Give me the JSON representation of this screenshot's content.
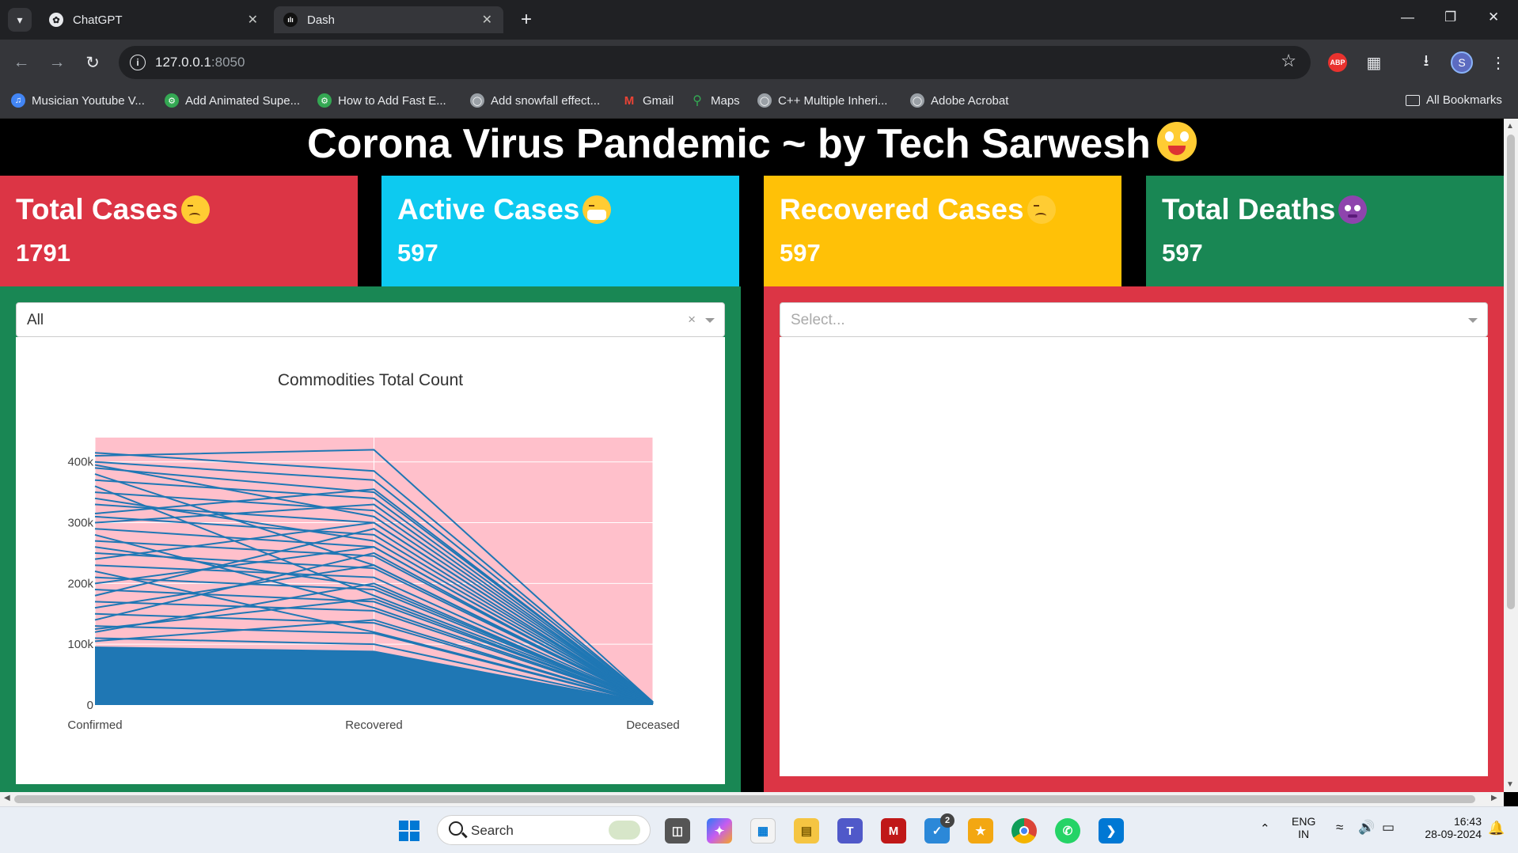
{
  "browser": {
    "tabs": [
      {
        "title": "ChatGPT",
        "icon": "chatgpt-icon"
      },
      {
        "title": "Dash",
        "icon": "dash-icon",
        "active": true
      }
    ],
    "url_host": "127.0.0.1",
    "url_port": ":8050",
    "bookmarks": [
      {
        "label": "Musician Youtube V...",
        "color": "#4285f4"
      },
      {
        "label": "Add Animated Supe...",
        "color": "#34a853"
      },
      {
        "label": "How to Add Fast E...",
        "color": "#34a853"
      },
      {
        "label": "Add snowfall effect...",
        "color": "#9aa0a6"
      },
      {
        "label": "Gmail",
        "color": "#ea4335"
      },
      {
        "label": "Maps",
        "color": "#fbbc05"
      },
      {
        "label": "C++ Multiple Inheri...",
        "color": "#9aa0a6"
      },
      {
        "label": "Adobe Acrobat",
        "color": "#9aa0a6"
      }
    ],
    "all_bookmarks": "All Bookmarks",
    "abp_label": "ABP",
    "profile_initial": "S"
  },
  "page": {
    "title": "Corona Virus Pandemic ~ by Tech Sarwesh",
    "cards": [
      {
        "title": "Total Cases",
        "value": "1791",
        "color": "#dc3545"
      },
      {
        "title": "Active Cases",
        "value": "597",
        "color": "#0dcaf0"
      },
      {
        "title": "Recovered Cases",
        "value": "597",
        "color": "#ffc107"
      },
      {
        "title": "Total Deaths",
        "value": "597",
        "color": "#198754"
      }
    ],
    "left_dropdown_value": "All",
    "right_dropdown_placeholder": "Select...",
    "left_panel_color": "#198754",
    "right_panel_color": "#dc3545"
  },
  "chart_data": {
    "type": "line",
    "title": "Commodities Total Count",
    "categories": [
      "Confirmed",
      "Recovered",
      "Deceased"
    ],
    "ylim": [
      0,
      440000
    ],
    "yticks": [
      0,
      100000,
      200000,
      300000,
      400000
    ],
    "ytick_labels": [
      "0",
      "100k",
      "200k",
      "300k",
      "400k"
    ],
    "plot_bgcolor": "#ffc0cb",
    "line_color": "#1f77b4",
    "series": [
      {
        "values": [
          410000,
          420000,
          5000
        ]
      },
      {
        "values": [
          415000,
          385000,
          4800
        ]
      },
      {
        "values": [
          400000,
          370000,
          4500
        ]
      },
      {
        "values": [
          390000,
          350000,
          4300
        ]
      },
      {
        "values": [
          370000,
          340000,
          4100
        ]
      },
      {
        "values": [
          350000,
          320000,
          3900
        ]
      },
      {
        "values": [
          330000,
          300000,
          3600
        ]
      },
      {
        "values": [
          310000,
          280000,
          3300
        ]
      },
      {
        "values": [
          290000,
          260000,
          3100
        ]
      },
      {
        "values": [
          270000,
          245000,
          2900
        ]
      },
      {
        "values": [
          250000,
          225000,
          2700
        ]
      },
      {
        "values": [
          230000,
          210000,
          2500
        ]
      },
      {
        "values": [
          210000,
          190000,
          2300
        ]
      },
      {
        "values": [
          190000,
          170000,
          2100
        ]
      },
      {
        "values": [
          170000,
          155000,
          1900
        ]
      },
      {
        "values": [
          150000,
          135000,
          1700
        ]
      },
      {
        "values": [
          130000,
          118000,
          1500
        ]
      },
      {
        "values": [
          110000,
          100000,
          1300
        ]
      },
      {
        "values": [
          95000,
          88000,
          1100
        ]
      },
      {
        "values": [
          360000,
          180000,
          3500
        ]
      },
      {
        "values": [
          300000,
          330000,
          3200
        ]
      },
      {
        "values": [
          240000,
          300000,
          2800
        ]
      },
      {
        "values": [
          200000,
          260000,
          2400
        ]
      },
      {
        "values": [
          160000,
          230000,
          2000
        ]
      },
      {
        "values": [
          120000,
          200000,
          1600
        ]
      },
      {
        "values": [
          380000,
          230000,
          3800
        ]
      },
      {
        "values": [
          280000,
          160000,
          2600
        ]
      },
      {
        "values": [
          220000,
          120000,
          2200
        ]
      },
      {
        "values": [
          180000,
          290000,
          1800
        ]
      },
      {
        "values": [
          140000,
          250000,
          1400
        ]
      },
      {
        "values": [
          340000,
          270000,
          3400
        ]
      },
      {
        "values": [
          260000,
          195000,
          2650
        ]
      },
      {
        "values": [
          395000,
          310000,
          4000
        ]
      },
      {
        "values": [
          105000,
          140000,
          1200
        ]
      },
      {
        "values": [
          125000,
          175000,
          1350
        ]
      },
      {
        "values": [
          315000,
          355000,
          3700
        ]
      }
    ]
  },
  "taskbar": {
    "search_label": "Search",
    "lang_top": "ENG",
    "lang_bottom": "IN",
    "time": "16:43",
    "date": "28-09-2024",
    "badge_count": "2"
  }
}
